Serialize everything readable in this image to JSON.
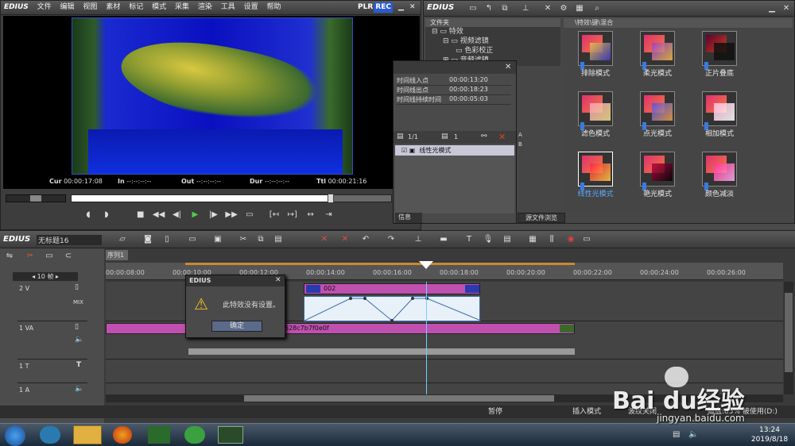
{
  "preview": {
    "logo": "EDIUS",
    "menu": [
      "文件",
      "编辑",
      "视图",
      "素材",
      "标记",
      "模式",
      "采集",
      "渲染",
      "工具",
      "设置",
      "帮助"
    ],
    "plr": "PLR",
    "rec": "REC",
    "timecodes": {
      "cur_label": "Cur",
      "cur": "00:00:17:08",
      "in_label": "In",
      "in": "--:--:--:--",
      "out_label": "Out",
      "out": "--:--:--:--",
      "dur_label": "Dur",
      "dur": "--:--:--:--",
      "ttl_label": "Ttl",
      "ttl": "00:00:21:16"
    }
  },
  "bin": {
    "logo": "EDIUS",
    "tree_header": "文件夹",
    "tree": [
      "特效",
      "视频滤镜",
      "色彩校正",
      "音频滤镜"
    ],
    "path": "\\特效\\键\\混合",
    "effects": [
      "排除模式",
      "柔光模式",
      "正片叠底",
      "滤色模式",
      "点光模式",
      "相加模式",
      "线性光模式",
      "艳光模式",
      "颜色减淡"
    ],
    "selected": "线性光模式",
    "source_tab": "源文件浏览"
  },
  "info": {
    "rows": [
      {
        "k": "时间线入点",
        "v": "00:00:13:20"
      },
      {
        "k": "时间线出点",
        "v": "00:00:18:23"
      },
      {
        "k": "时间线持续时间",
        "v": "00:00:05:03"
      }
    ],
    "page": "1/1",
    "count": "1",
    "filter_name": "线性光模式",
    "tab": "信息",
    "side_letters": [
      "A",
      "B"
    ]
  },
  "timeline": {
    "logo": "EDIUS",
    "project": "无标题16",
    "sequence_tab": "序列1",
    "zoom": "10 帧",
    "ruler": [
      "00:00:08:00",
      "00:00:10:00",
      "00:00:12:00",
      "00:00:14:00",
      "00:00:16:00",
      "00:00:18:00",
      "00:00:20:00",
      "00:00:22:00",
      "00:00:24:00",
      "00:00:26:00"
    ],
    "tracks": [
      {
        "name": "2 V",
        "mix": "MIX"
      },
      {
        "name": "1 VA"
      },
      {
        "name": "1 T"
      },
      {
        "name": "1 A"
      }
    ],
    "clip_v2": "002",
    "clip_va": "528c7b7f0e0f"
  },
  "dialog": {
    "title": "EDIUS",
    "message": "此特效没有设置。",
    "ok": "确定"
  },
  "status": {
    "items": [
      "暂停",
      "插入模式",
      "波纹关闭",
      "磁盘:85% 被使用(D:)"
    ]
  },
  "taskbar": {
    "time": "13:24",
    "date": "2019/8/18"
  },
  "watermark": {
    "brand": "Bai du经验",
    "url": "jingyan.baidu.com"
  }
}
